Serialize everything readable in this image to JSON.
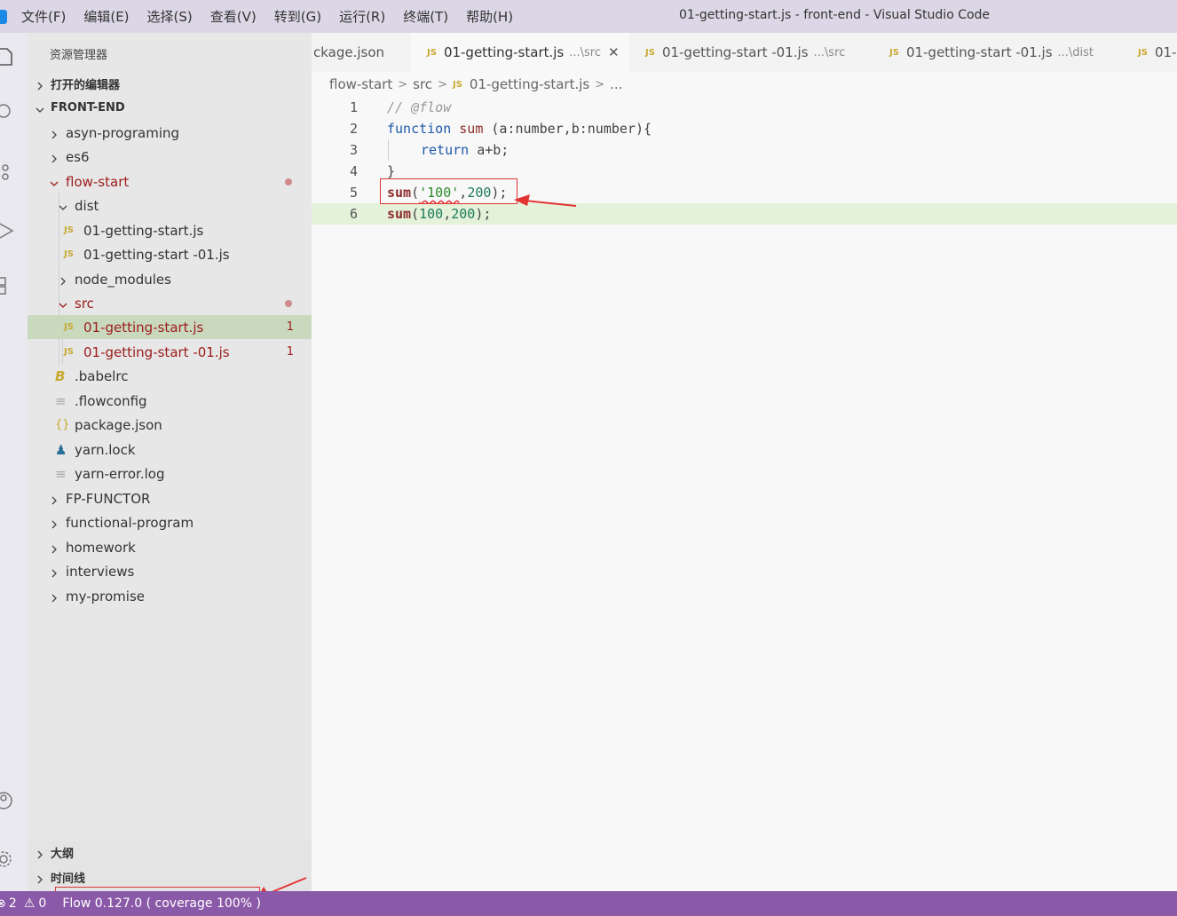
{
  "window": {
    "title": "01-getting-start.js - front-end - Visual Studio Code",
    "menu": [
      "文件(F)",
      "编辑(E)",
      "选择(S)",
      "查看(V)",
      "转到(G)",
      "运行(R)",
      "终端(T)",
      "帮助(H)"
    ]
  },
  "sidebar": {
    "header": "资源管理器",
    "open_editors": "打开的编辑器",
    "root": "FRONT-END",
    "items": [
      {
        "label": "asyn-programing"
      },
      {
        "label": "es6"
      },
      {
        "label": "flow-start"
      },
      {
        "label": "dist"
      },
      {
        "label": "01-getting-start.js"
      },
      {
        "label": "01-getting-start -01.js"
      },
      {
        "label": "node_modules"
      },
      {
        "label": "src"
      },
      {
        "label": "01-getting-start.js",
        "badge": "1"
      },
      {
        "label": "01-getting-start -01.js",
        "badge": "1"
      },
      {
        "label": ".babelrc"
      },
      {
        "label": ".flowconfig"
      },
      {
        "label": "package.json"
      },
      {
        "label": "yarn.lock"
      },
      {
        "label": "yarn-error.log"
      },
      {
        "label": "FP-FUNCTOR"
      },
      {
        "label": "functional-program"
      },
      {
        "label": "homework"
      },
      {
        "label": "interviews"
      },
      {
        "label": "my-promise"
      }
    ],
    "outline": "大纲",
    "timeline": "时间线"
  },
  "tabs": [
    {
      "label": "ckage.json",
      "path": ""
    },
    {
      "label": "01-getting-start.js",
      "path": "...\\src",
      "close": "✕"
    },
    {
      "label": "01-getting-start -01.js",
      "path": "...\\src"
    },
    {
      "label": "01-getting-start -01.js",
      "path": "...\\dist"
    },
    {
      "label": "01-",
      "path": ""
    }
  ],
  "breadcrumb": {
    "parts": [
      "flow-start",
      "src",
      "01-getting-start.js",
      "..."
    ]
  },
  "editor": {
    "line_numbers": [
      "1",
      "2",
      "3",
      "4",
      "5",
      "6"
    ],
    "lines": {
      "l1": "// @flow",
      "l2_kw": "function",
      "l2_fn": "sum",
      "l2_rest": " (a:number,b:number){",
      "l3_kw": "return",
      "l3_rest": " a+b;",
      "l4": "}",
      "l5_fn": "sum",
      "l5_open": "(",
      "l5_str": "'100'",
      "l5_comma": ",",
      "l5_num": "200",
      "l5_close": ");",
      "l6_fn": "sum",
      "l6_open": "(",
      "l6_num1": "100",
      "l6_comma": ",",
      "l6_num2": "200",
      "l6_close": ");"
    }
  },
  "statusbar": {
    "errors": "2",
    "warnings": "0",
    "flow": "Flow 0.127.0 ( coverage 100% )"
  },
  "colors": {
    "titlebar": "#dcd7e6",
    "statusbar": "#8a59a8",
    "selection": "#c9d9be",
    "current_line": "#e4f2d9",
    "annotation_red": "#e23333"
  }
}
